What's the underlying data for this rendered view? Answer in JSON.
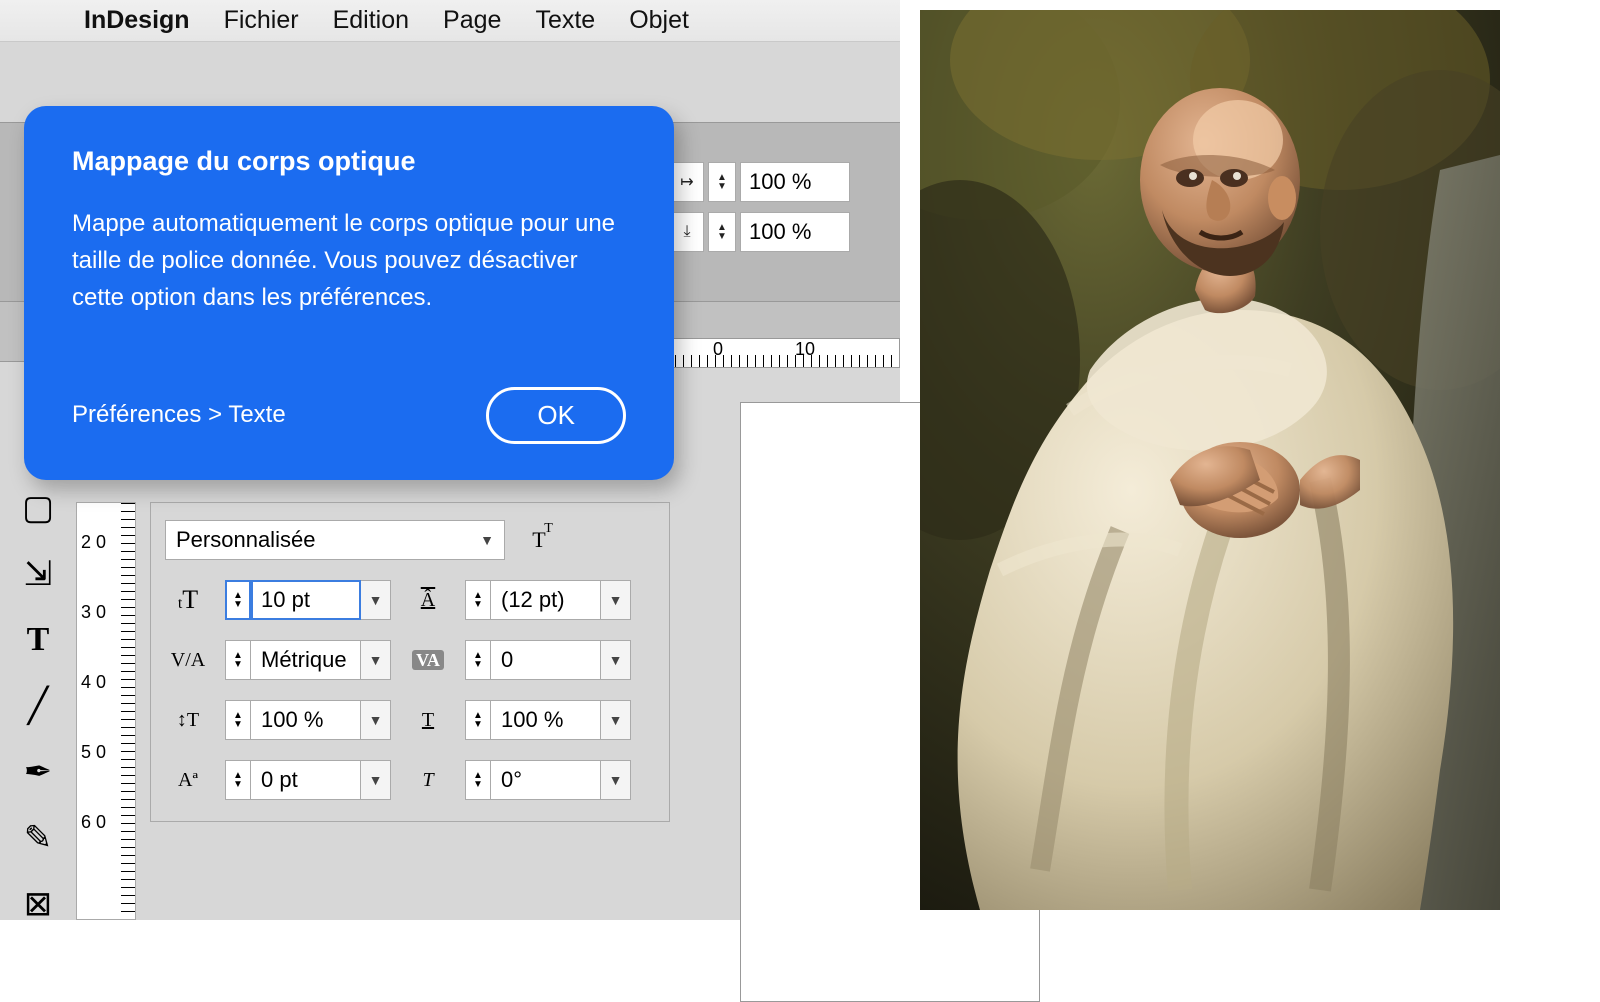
{
  "menubar": {
    "app": "InDesign",
    "items": [
      "Fichier",
      "Edition",
      "Page",
      "Texte",
      "Objet"
    ]
  },
  "tooltip": {
    "title": "Mappage du corps optique",
    "body": "Mappe automatiquement le corps optique pour une taille de police donnée. Vous pouvez désactiver cette option dans les préférences.",
    "pref_path": "Préférences  >  Texte",
    "ok": "OK"
  },
  "scale": {
    "horiz": "100 %",
    "vert": "100 %"
  },
  "ruler_h": {
    "tick0": "0",
    "tick10": "10"
  },
  "ruler_v": {
    "n20": "2\n0",
    "n30": "3\n0",
    "n40": "4\n0",
    "n50": "5\n0",
    "n60": "6\n0"
  },
  "panel": {
    "optical_size": "Personnalisée",
    "font_size": "10 pt",
    "leading": "(12 pt)",
    "kerning": "Métrique",
    "tracking": "0",
    "vert_scale": "100 %",
    "horz_scale": "100 %",
    "baseline": "0 pt",
    "skew": "0°"
  },
  "icons": {
    "optical": "TT",
    "size": "tT",
    "leading": "tÂ",
    "kerning": "V/A",
    "tracking": "VA",
    "vscale": "↕T",
    "hscale": "T",
    "baseline": "Aª",
    "skew": "T"
  }
}
